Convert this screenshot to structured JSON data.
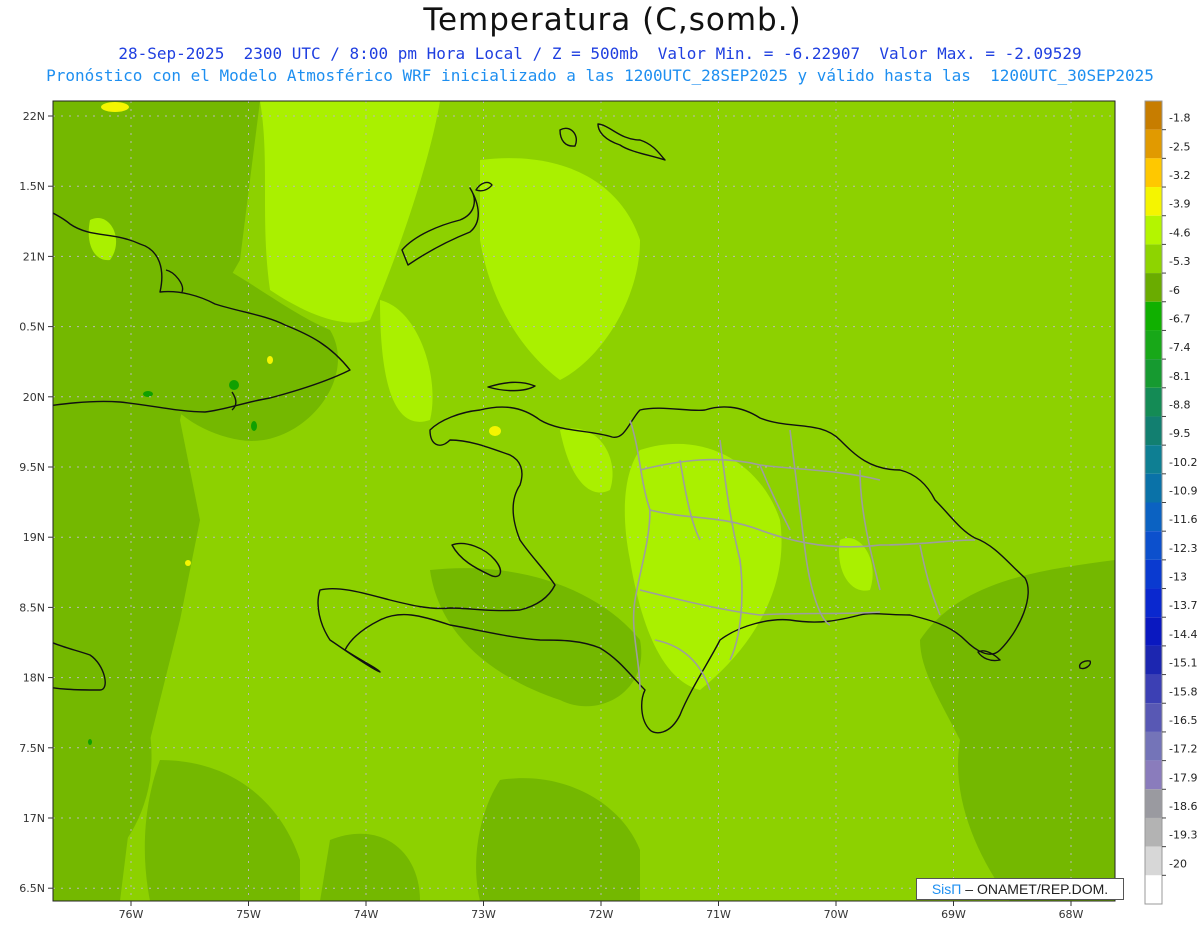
{
  "title": "Temperatura (C,somb.)",
  "subtitle_line1": "28-Sep-2025  2300 UTC / 8:00 pm Hora Local / Z = 500mb  Valor Min. = -6.22907  Valor Max. = -2.09529",
  "subtitle_line2": "Pronóstico con el Modelo Atmosférico WRF inicializado a las 1200UTC_28SEP2025 y válido hasta las  1200UTC_30SEP2025",
  "credit": {
    "brand": "SisΠ",
    "org": " – ONAMET/REP.DOM."
  },
  "map": {
    "lon_ticks": [
      "76W",
      "75W",
      "74W",
      "73W",
      "72W",
      "71W",
      "70W",
      "69W",
      "68W"
    ],
    "lat_ticks": [
      "22N",
      "1.5N",
      "21N",
      "0.5N",
      "20N",
      "9.5N",
      "19N",
      "8.5N",
      "18N",
      "7.5N",
      "17N",
      "6.5N"
    ],
    "background_color": "#8dd100",
    "coast_color": "#111111",
    "border_color": "#9e9e9e"
  },
  "colorbar": {
    "labels": [
      "-1.8",
      "-2.5",
      "-3.2",
      "-3.9",
      "-4.6",
      "-5.3",
      "-6",
      "-6.7",
      "-7.4",
      "-8.1",
      "-8.8",
      "-9.5",
      "-10.2",
      "-10.9",
      "-11.6",
      "-12.3",
      "-13",
      "-13.7",
      "-14.4",
      "-15.1",
      "-15.8",
      "-16.5",
      "-17.2",
      "-17.9",
      "-18.6",
      "-19.3",
      "-20"
    ],
    "colors": [
      "#c77d00",
      "#e19a00",
      "#ffc800",
      "#f5f500",
      "#b4f500",
      "#8ed400",
      "#6aac00",
      "#10b000",
      "#18a818",
      "#169a30",
      "#148b55",
      "#127f70",
      "#0e7f93",
      "#0a72a8",
      "#0b62c2",
      "#0c50cd",
      "#0a3ad0",
      "#0a28cf",
      "#0a18c0",
      "#1c26b0",
      "#3c40b4",
      "#5858b4",
      "#7474b8",
      "#8a7cbc",
      "#9a9aa0",
      "#b3b3b3",
      "#d7d7d7",
      "#ffffff"
    ]
  }
}
